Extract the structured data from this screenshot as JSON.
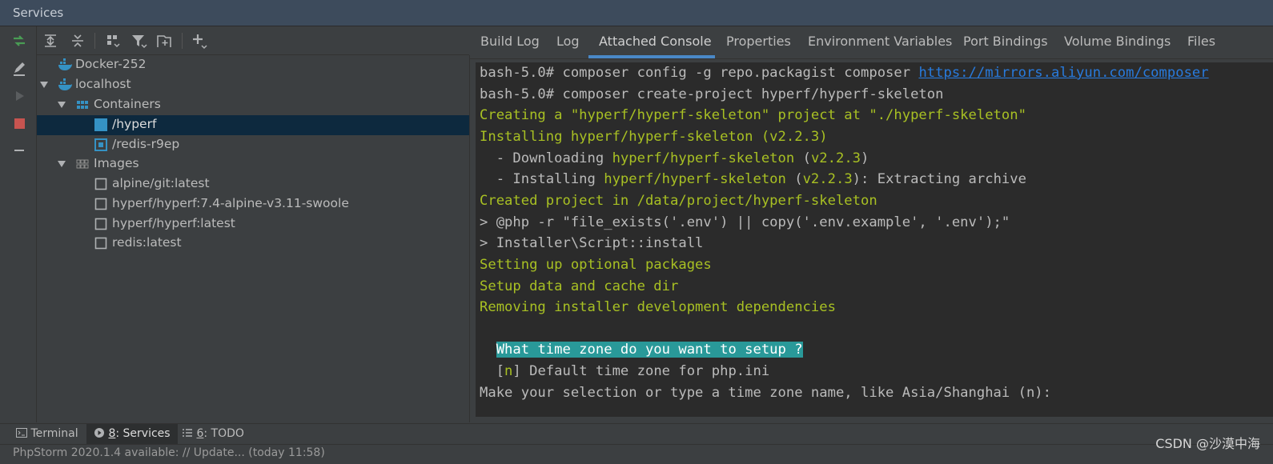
{
  "window": {
    "title": "Services"
  },
  "left_tools": [
    "rerun-icon",
    "edit-icon",
    "run-icon",
    "stop-icon",
    "collapse-icon"
  ],
  "tree_toolbar": [
    "expand-all-icon",
    "collapse-all-icon",
    "group-icon",
    "filter-icon",
    "new-group-icon",
    "add-icon"
  ],
  "tree": {
    "docker252": "Docker-252",
    "localhost": "localhost",
    "containers": "Containers",
    "hyperf": "/hyperf",
    "redis_container": "/redis-r9ep",
    "images": "Images",
    "img1": "alpine/git:latest",
    "img2": "hyperf/hyperf:7.4-alpine-v3.11-swoole",
    "img3": "hyperf/hyperf:latest",
    "img4": "redis:latest"
  },
  "tabs": [
    "Build Log",
    "Log",
    "Attached Console",
    "Properties",
    "Environment Variables",
    "Port Bindings",
    "Volume Bindings",
    "Files"
  ],
  "active_tab": "Attached Console",
  "console": {
    "l1_prompt": "bash-5.0# composer config -g repo.packagist composer ",
    "l1_link": "https://mirrors.aliyun.com/composer",
    "l2": "bash-5.0# composer create-project hyperf/hyperf-skeleton",
    "l3": "Creating a \"hyperf/hyperf-skeleton\" project at \"./hyperf-skeleton\"",
    "l4": "Installing hyperf/hyperf-skeleton (v2.2.3)",
    "l5a": "  - Downloading ",
    "l5b": "hyperf/hyperf-skeleton",
    "l5c": " (",
    "l5d": "v2.2.3",
    "l5e": ")",
    "l6a": "  - Installing ",
    "l6b": "hyperf/hyperf-skeleton",
    "l6c": " (",
    "l6d": "v2.2.3",
    "l6e": "): Extracting archive",
    "l7": "Created project in /data/project/hyperf-skeleton",
    "l8": "> @php -r \"file_exists('.env') || copy('.env.example', '.env');\"",
    "l9": "> Installer\\Script::install",
    "l10": "Setting up optional packages",
    "l11": "Setup data and cache dir",
    "l12": "Removing installer development dependencies",
    "l13_indent": "  ",
    "l13": "What time zone do you want to setup ?",
    "l14a": "  [",
    "l14b": "n",
    "l14c": "] Default time zone for php.ini",
    "l15": "Make your selection or type a time zone name, like Asia/Shanghai (n):"
  },
  "bottom_tabs": {
    "terminal": "Terminal",
    "services_num": "8",
    "services_label": ": Services",
    "todo_num": "6",
    "todo_label": ": TODO"
  },
  "status": "PhpStorm 2020.1.4 available: // Update... (today 11:58)",
  "watermark": "CSDN @沙漠中海",
  "colors": {
    "accent": "#4a88c7",
    "selection": "#0d293e",
    "console_green": "#a8c023",
    "highlight": "#299999",
    "link": "#287bde",
    "stop_red": "#c75450",
    "run_green": "#499c54",
    "docker_blue": "#3592c4"
  }
}
